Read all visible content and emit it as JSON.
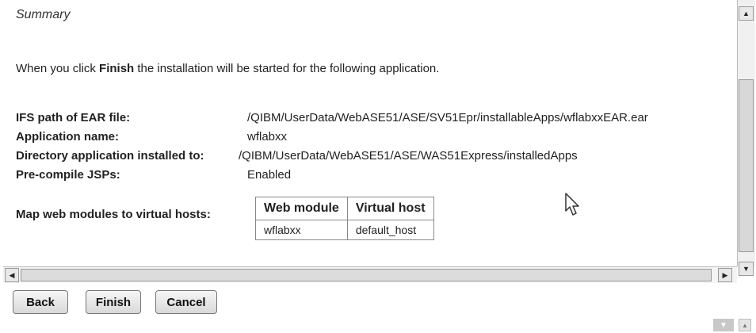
{
  "summary": {
    "title": "Summary",
    "intro_prefix": "When you click ",
    "intro_bold": "Finish",
    "intro_suffix": " the installation will be started for the following application.",
    "rows": [
      {
        "label": "IFS path of EAR file:",
        "value": "/QIBM/UserData/WebASE51/ASE/SV51Epr/installableApps/wflabxxEAR.ear"
      },
      {
        "label": "Application name:",
        "value": "wflabxx"
      },
      {
        "label": "Directory application installed to:",
        "value": "/QIBM/UserData/WebASE51/ASE/WAS51Express/installedApps"
      },
      {
        "label": "Pre-compile JSPs:",
        "value": "Enabled"
      }
    ],
    "map_label": "Map web modules to virtual hosts:",
    "modules_table": {
      "headers": [
        "Web module",
        "Virtual host"
      ],
      "rows": [
        [
          "wflabxx",
          "default_host"
        ]
      ]
    }
  },
  "buttons": {
    "back": "Back",
    "finish": "Finish",
    "cancel": "Cancel"
  },
  "icons": {
    "scroll_up": "arrow-up-icon",
    "scroll_down": "arrow-down-icon",
    "scroll_left": "arrow-left-icon",
    "scroll_right": "arrow-right-icon",
    "cursor": "mouse-pointer-icon"
  }
}
